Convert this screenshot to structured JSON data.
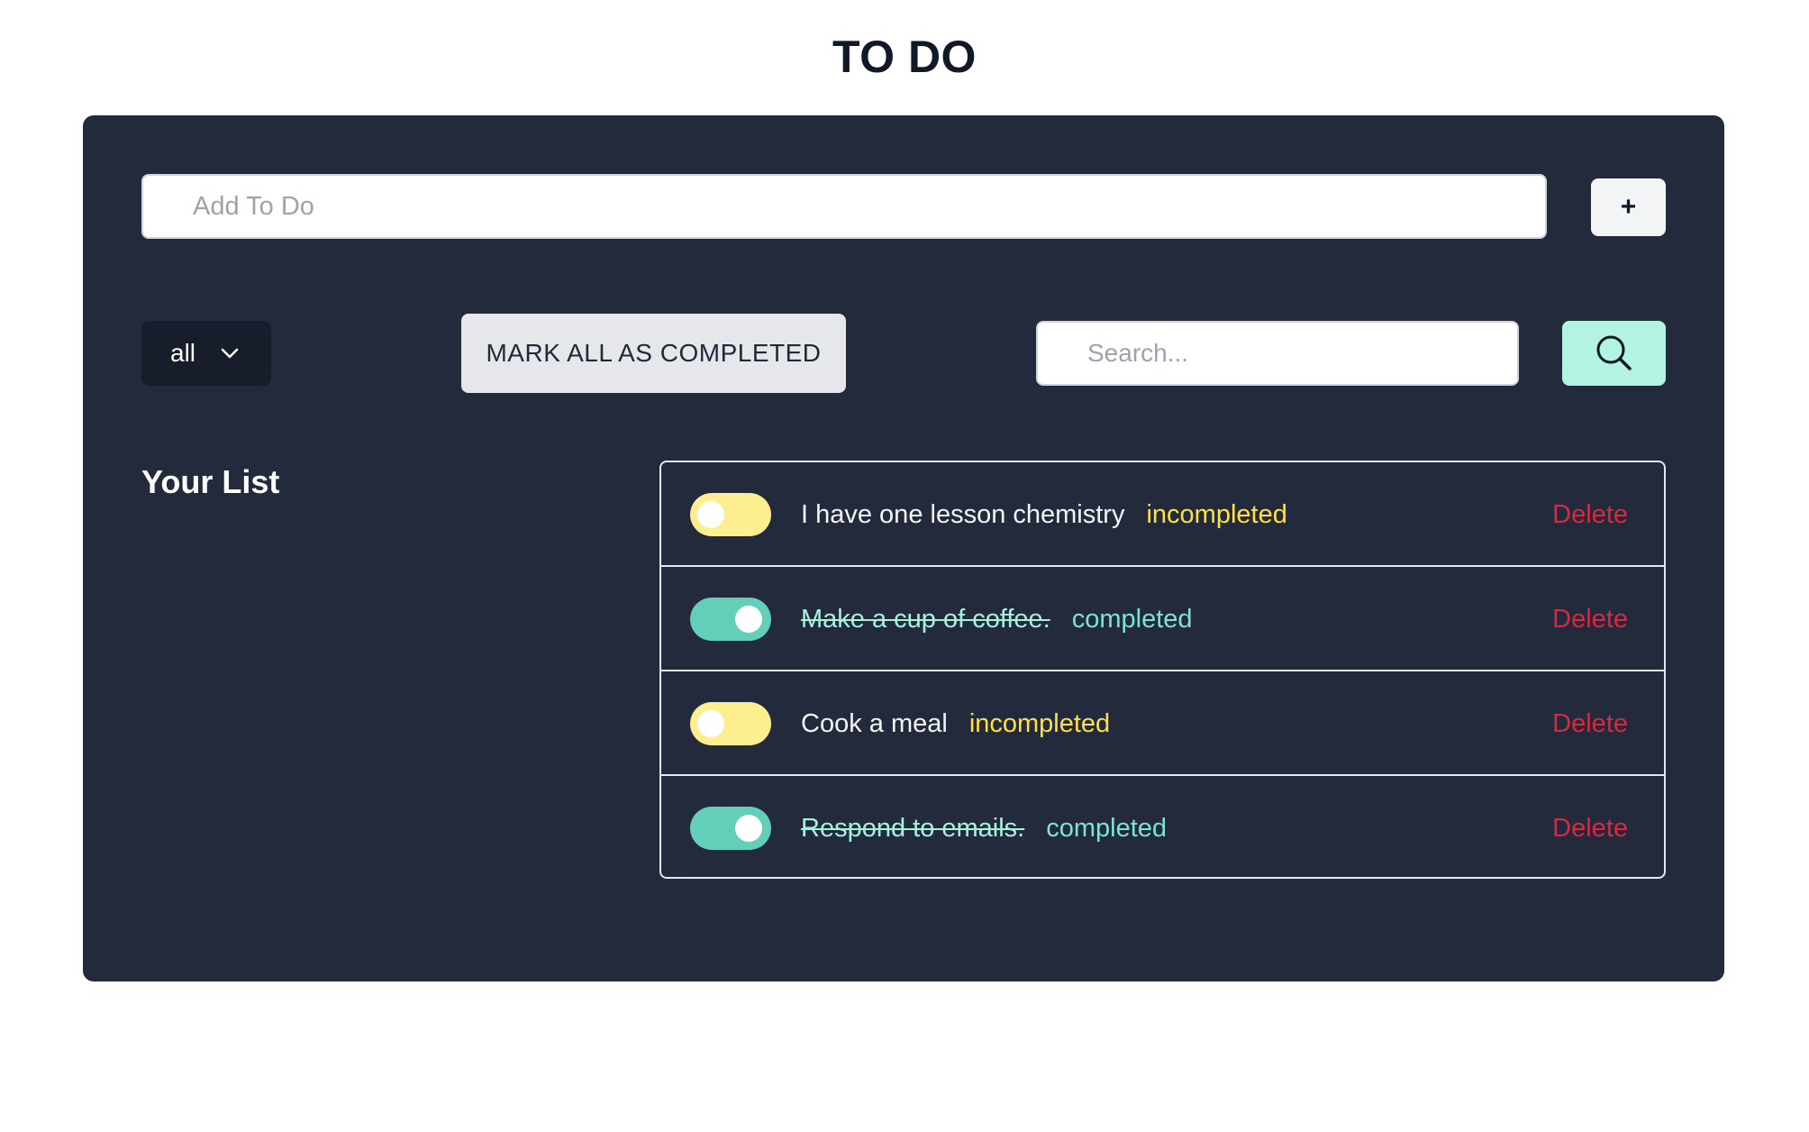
{
  "header": {
    "title": "TO DO"
  },
  "add_form": {
    "placeholder": "Add To Do",
    "value": "",
    "add_button_label": "+"
  },
  "toolbar": {
    "filter_selected": "all",
    "mark_all_label": "MARK ALL AS COMPLETED",
    "search_placeholder": "Search...",
    "search_value": "",
    "search_icon": "search-icon"
  },
  "list": {
    "heading": "Your List",
    "items": [
      {
        "text": "I have one lesson chemistry",
        "status": "incompleted",
        "completed": false,
        "delete_label": "Delete"
      },
      {
        "text": "Make a cup of coffee.",
        "status": "completed",
        "completed": true,
        "delete_label": "Delete"
      },
      {
        "text": "Cook a meal",
        "status": "incompleted",
        "completed": false,
        "delete_label": "Delete"
      },
      {
        "text": "Respond to emails.",
        "status": "completed",
        "completed": true,
        "delete_label": "Delete"
      }
    ]
  },
  "colors": {
    "panel_background": "#222a3b",
    "toggle_off": "#fdee8f",
    "toggle_on": "#63cfb8",
    "incompleted_status": "#fde047",
    "completed_status": "#7ee4cb",
    "delete": "#d52b42",
    "search_button": "#b3f3e1"
  }
}
